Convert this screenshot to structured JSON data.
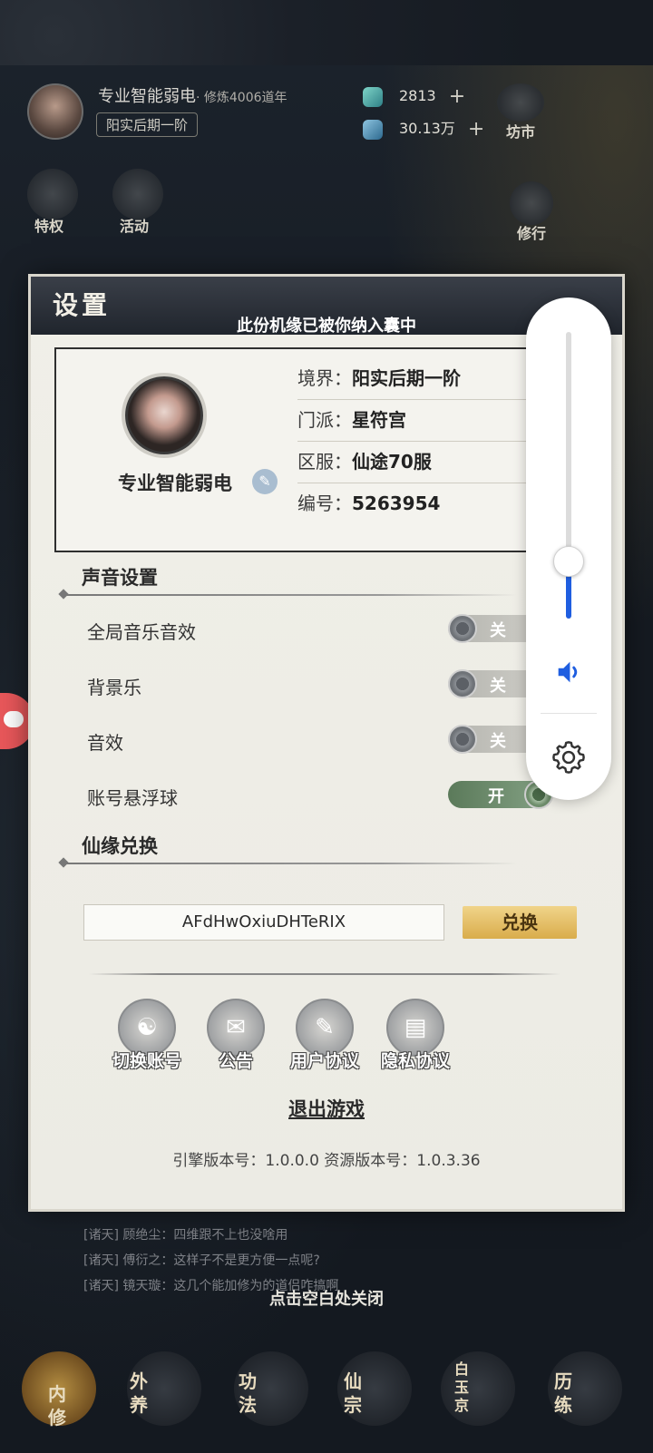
{
  "player": {
    "name": "专业智能弱电",
    "cultivation": "· 修炼4006道年",
    "realm_badge": "阳实后期一阶",
    "currency1": "2813",
    "currency2": "30.13万",
    "shop_label": "坊市"
  },
  "top_menu": {
    "privilege": "特权",
    "activity": "活动",
    "practice": "修行"
  },
  "chat": [
    "[诸天] 顾绝尘：四维跟不上也没啥用",
    "[诸天] 傅衍之：这样子不是更方便一点呢?",
    "[诸天] 镜天璇：这几个能加修为的道侣咋搞啊"
  ],
  "close_hint": "点击空白处关闭",
  "bottom_nav": [
    "内修",
    "外养",
    "功法",
    "仙宗",
    "白玉京",
    "历练"
  ],
  "dialog": {
    "title": "设置",
    "banner": "此份机缘已被你纳入囊中",
    "profile": {
      "name": "专业智能弱电",
      "info": [
        {
          "key": "境界：",
          "value": "阳实后期一阶"
        },
        {
          "key": "门派：",
          "value": "星符宫"
        },
        {
          "key": "区服：",
          "value": "仙途70服"
        },
        {
          "key": "编号：",
          "value": "5263954"
        }
      ]
    },
    "sound_section": "声音设置",
    "settings": [
      {
        "label": "全局音乐音效",
        "state": "关",
        "on": false
      },
      {
        "label": "背景乐",
        "state": "关",
        "on": false
      },
      {
        "label": "音效",
        "state": "关",
        "on": false
      },
      {
        "label": "账号悬浮球",
        "state": "开",
        "on": true
      }
    ],
    "redeem_section": "仙缘兑换",
    "redeem_code": "AFdHwOxiuDHTeRIX",
    "redeem_button": "兑换",
    "links": [
      "切换账号",
      "公告",
      "用户协议",
      "隐私协议"
    ],
    "exit": "退出游戏",
    "version": "引擎版本号：1.0.0.0 资源版本号：1.0.3.36"
  },
  "volume": {
    "level_percent": 20,
    "accent": "#1f5ee0"
  }
}
